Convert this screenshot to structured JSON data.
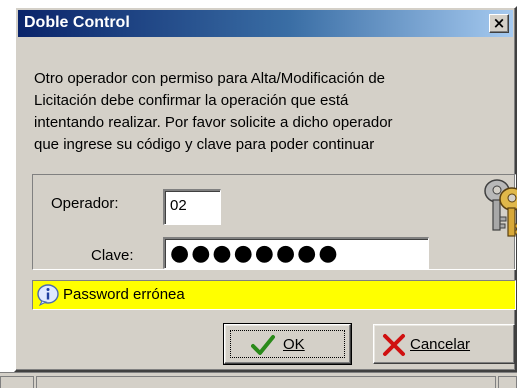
{
  "window": {
    "title": "Doble Control",
    "close_label": "×"
  },
  "message": {
    "lines": [
      "Otro operador con permiso para Alta/Modificación de",
      "Licitación debe confirmar la operación que está",
      "intentando realizar. Por favor solicite a dicho operador",
      "que ingrese su código y clave para poder continuar"
    ]
  },
  "form": {
    "operador_label": "Operador:",
    "operador_value": "02",
    "clave_label": "Clave:",
    "clave_masked": "●●●●●●●●",
    "clave_length": 8
  },
  "status": {
    "text": "Password errónea",
    "background": "#ffff00",
    "icon": "info-icon"
  },
  "buttons": {
    "ok_label": "OK",
    "cancel_label": "Cancelar",
    "ok_icon": "checkmark-icon",
    "cancel_icon": "x-cross-icon"
  },
  "colors": {
    "titlebar_start": "#0a246a",
    "titlebar_end": "#a6caf0",
    "dialog_face": "#d4d0c8"
  }
}
